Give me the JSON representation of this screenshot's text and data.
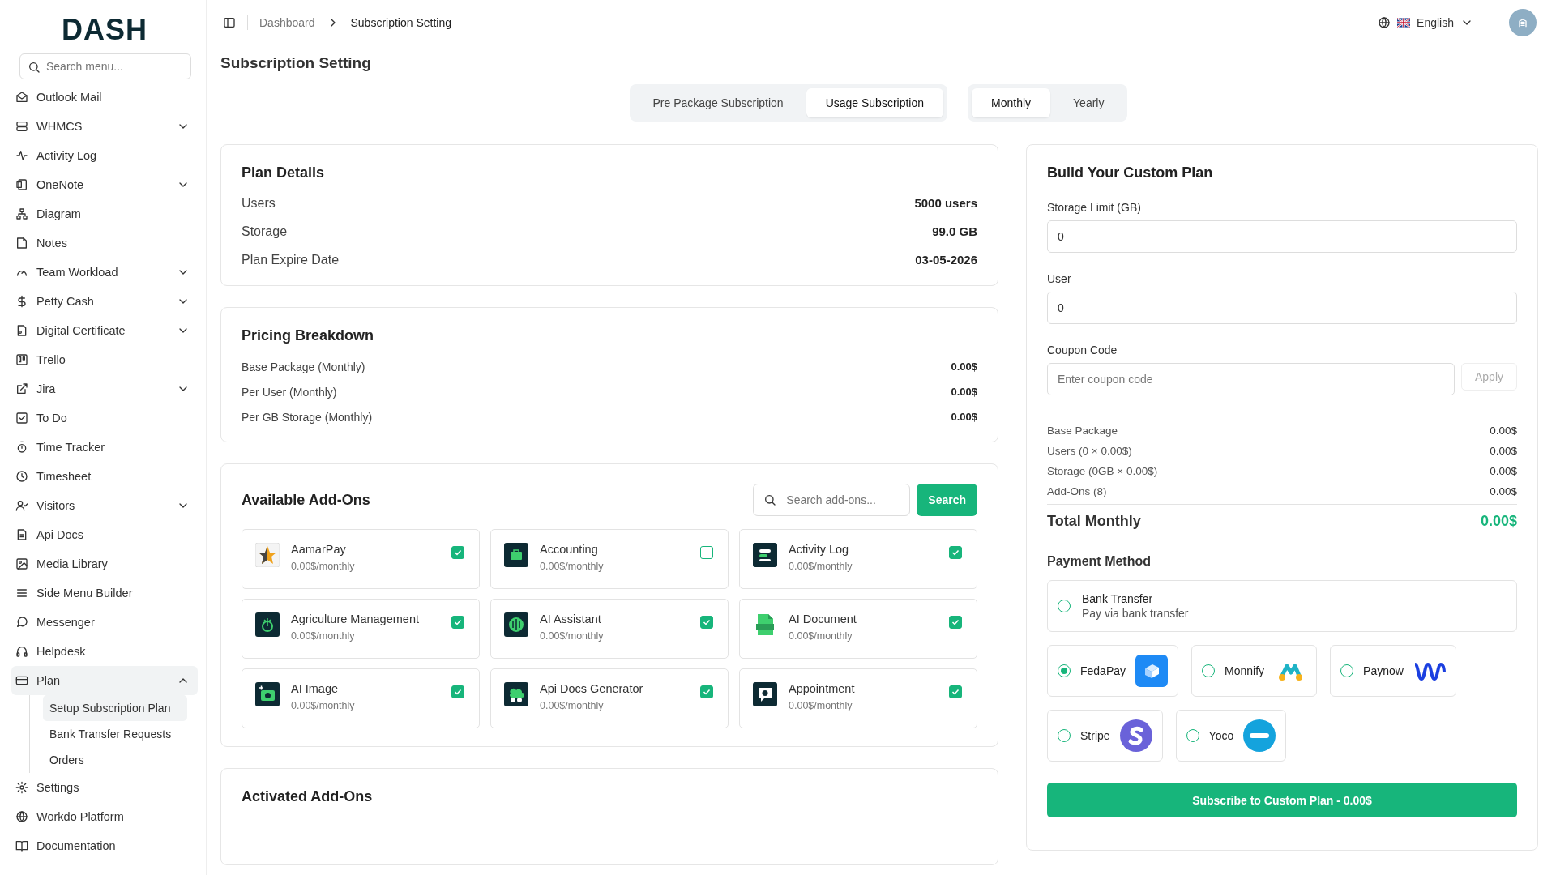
{
  "sidebar": {
    "logo": "DASH",
    "search": {
      "placeholder": "Search menu..."
    },
    "items": [
      {
        "label": "Outlook Mail",
        "selected": false
      },
      {
        "label": "WHMCS",
        "selected": false,
        "expanded": false
      },
      {
        "label": "Activity Log",
        "selected": false
      },
      {
        "label": "OneNote",
        "selected": false,
        "expanded": false
      },
      {
        "label": "Diagram",
        "selected": false
      },
      {
        "label": "Notes",
        "selected": false
      },
      {
        "label": "Team Workload",
        "selected": false,
        "expanded": false
      },
      {
        "label": "Petty Cash",
        "selected": false,
        "expanded": false
      },
      {
        "label": "Digital Certificate",
        "selected": false,
        "expanded": false
      },
      {
        "label": "Trello",
        "selected": false
      },
      {
        "label": "Jira",
        "selected": false,
        "expanded": false
      },
      {
        "label": "To Do",
        "selected": false
      },
      {
        "label": "Time Tracker",
        "selected": false
      },
      {
        "label": "Timesheet",
        "selected": false
      },
      {
        "label": "Visitors",
        "selected": false,
        "expanded": false
      },
      {
        "label": "Api Docs",
        "selected": false
      },
      {
        "label": "Media Library",
        "selected": false
      },
      {
        "label": "Side Menu Builder",
        "selected": false
      },
      {
        "label": "Messenger",
        "selected": false
      },
      {
        "label": "Helpdesk",
        "selected": false
      },
      {
        "label": "Plan",
        "selected": true,
        "expanded": true,
        "children": [
          {
            "label": "Setup Subscription Plan",
            "selected": true
          },
          {
            "label": "Bank Transfer Requests",
            "selected": false
          },
          {
            "label": "Orders",
            "selected": false
          }
        ]
      },
      {
        "label": "Settings",
        "selected": false
      },
      {
        "label": "Workdo Platform",
        "selected": false
      },
      {
        "label": "Documentation",
        "selected": false
      }
    ]
  },
  "header": {
    "breadcrumbs": [
      "Dashboard",
      "Subscription Setting"
    ],
    "language": "English"
  },
  "page_title": "Subscription Setting",
  "subscription_tabs": [
    {
      "label": "Pre Package Subscription",
      "selected": false
    },
    {
      "label": "Usage Subscription",
      "selected": true
    }
  ],
  "period_tabs": [
    {
      "label": "Monthly",
      "selected": true
    },
    {
      "label": "Yearly",
      "selected": false
    }
  ],
  "plan_details": {
    "title": "Plan Details",
    "rows": [
      {
        "label": "Users",
        "value": "5000 users"
      },
      {
        "label": "Storage",
        "value": "99.0 GB"
      },
      {
        "label": "Plan Expire Date",
        "value": "03-05-2026"
      }
    ]
  },
  "pricing_breakdown": {
    "title": "Pricing Breakdown",
    "rows": [
      {
        "label": "Base Package (Monthly)",
        "value": "0.00$"
      },
      {
        "label": "Per User (Monthly)",
        "value": "0.00$"
      },
      {
        "label": "Per GB Storage (Monthly)",
        "value": "0.00$"
      }
    ]
  },
  "available_addons": {
    "title": "Available Add-Ons",
    "search": {
      "placeholder": "Search add-ons..."
    },
    "search_button": "Search",
    "items": [
      {
        "name": "AamarPay",
        "price": "0.00$/monthly",
        "checked": true
      },
      {
        "name": "Accounting",
        "price": "0.00$/monthly",
        "checked": false
      },
      {
        "name": "Activity Log",
        "price": "0.00$/monthly",
        "checked": true
      },
      {
        "name": "Agriculture Management",
        "price": "0.00$/monthly",
        "checked": true
      },
      {
        "name": "AI Assistant",
        "price": "0.00$/monthly",
        "checked": true
      },
      {
        "name": "AI Document",
        "price": "0.00$/monthly",
        "checked": true
      },
      {
        "name": "AI Image",
        "price": "0.00$/monthly",
        "checked": true
      },
      {
        "name": "Api Docs Generator",
        "price": "0.00$/monthly",
        "checked": true
      },
      {
        "name": "Appointment",
        "price": "0.00$/monthly",
        "checked": true
      }
    ]
  },
  "activated_addons": {
    "title": "Activated Add-Ons"
  },
  "custom_plan": {
    "title": "Build Your Custom Plan",
    "fields": [
      {
        "label": "Storage Limit (GB)",
        "value": "0"
      },
      {
        "label": "User",
        "value": "0"
      }
    ],
    "coupon": {
      "label": "Coupon Code",
      "placeholder": "Enter coupon code",
      "button": "Apply"
    },
    "summary": [
      {
        "label": "Base Package",
        "value": "0.00$"
      },
      {
        "label": "Users (0 × 0.00$)",
        "value": "0.00$"
      },
      {
        "label": "Storage (0GB × 0.00$)",
        "value": "0.00$"
      },
      {
        "label": "Add-Ons (8)",
        "value": "0.00$"
      }
    ],
    "total": {
      "label": "Total Monthly",
      "value": "0.00$"
    },
    "payment_title": "Payment Method",
    "payment_methods": [
      {
        "kind": "wide",
        "name": "Bank Transfer",
        "description": "Pay via bank transfer",
        "selected": false
      },
      {
        "kind": "logo",
        "name": "FedaPay",
        "selected": true
      },
      {
        "kind": "logo",
        "name": "Monnify",
        "selected": false
      },
      {
        "kind": "logo",
        "name": "Paynow",
        "selected": false
      },
      {
        "kind": "logo",
        "name": "Stripe",
        "selected": false
      },
      {
        "kind": "logo",
        "name": "Yoco",
        "selected": false
      }
    ],
    "subscribe_button": "Subscribe to Custom Plan - 0.00$"
  }
}
